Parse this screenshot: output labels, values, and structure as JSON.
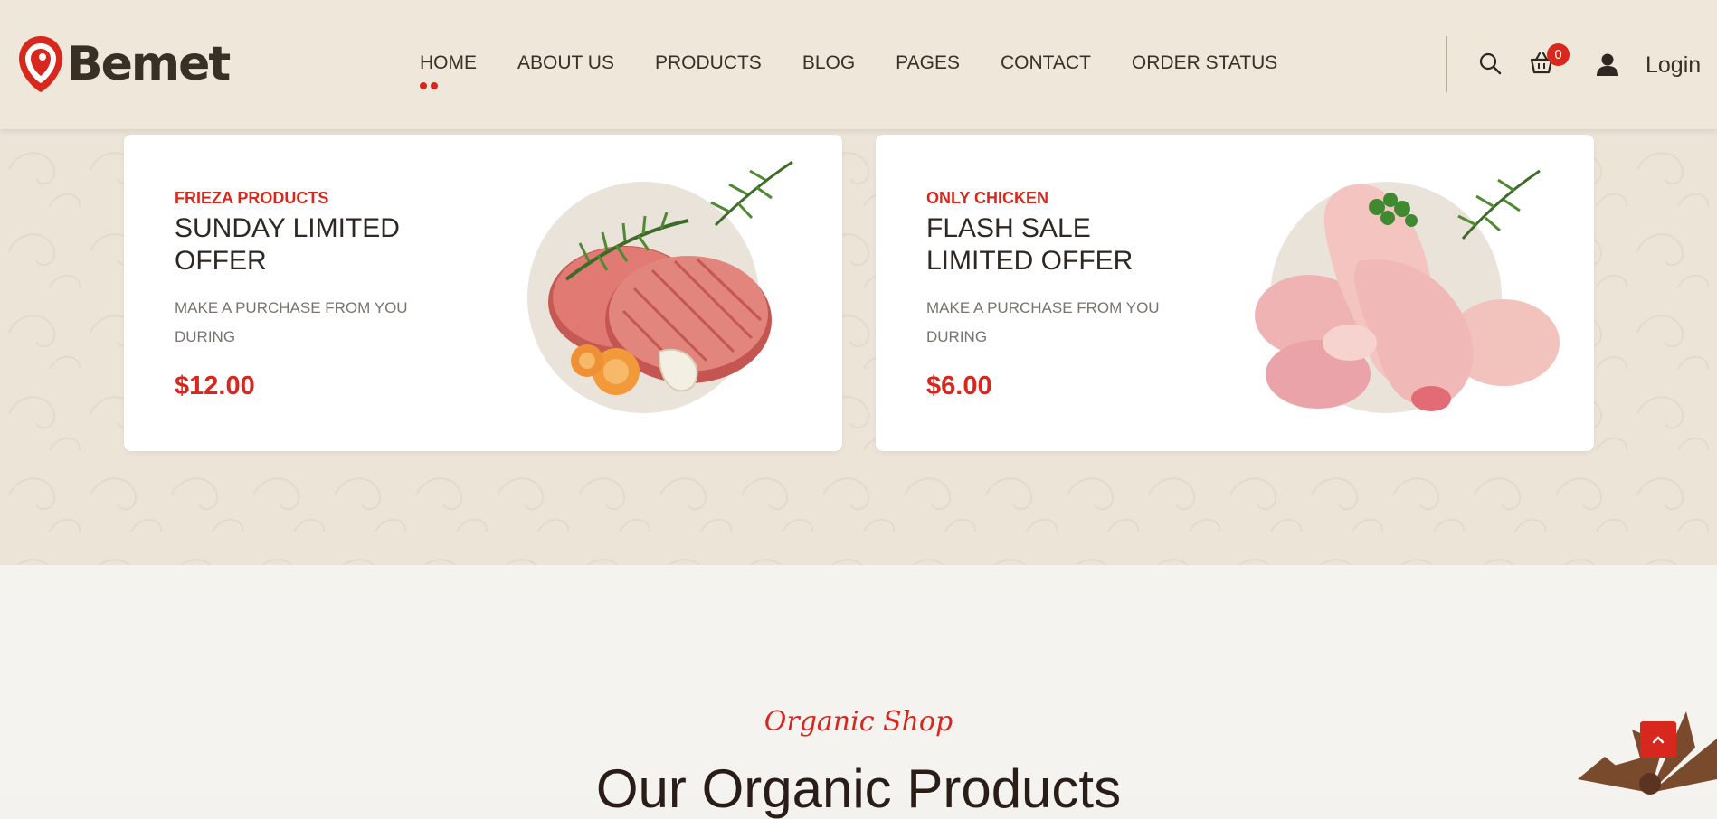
{
  "brand": {
    "name": "Bemet"
  },
  "nav": {
    "items": [
      {
        "label": "HOME",
        "active": true
      },
      {
        "label": "ABOUT US"
      },
      {
        "label": "PRODUCTS"
      },
      {
        "label": "BLOG"
      },
      {
        "label": "PAGES"
      },
      {
        "label": "CONTACT"
      },
      {
        "label": "ORDER STATUS"
      }
    ]
  },
  "header": {
    "cart_count": "0",
    "login_label": "Login",
    "icons": [
      "search-icon",
      "cart-icon",
      "user-icon"
    ]
  },
  "offers": [
    {
      "kicker": "FRIEZA PRODUCTS",
      "title": "SUNDAY LIMITED OFFER",
      "description": "MAKE A PURCHASE FROM YOU DURING",
      "price": "$12.00",
      "image": "burger-patties"
    },
    {
      "kicker": "ONLY CHICKEN",
      "title": "FLASH SALE LIMITED OFFER",
      "description": "MAKE A PURCHASE FROM YOU DURING",
      "price": "$6.00",
      "image": "raw-chicken"
    }
  ],
  "organic": {
    "subtitle": "Organic Shop",
    "title": "Our Organic Products"
  },
  "colors": {
    "accent": "#d8281d",
    "header_bg": "#efe7da",
    "text_dark": "#3b2f28"
  }
}
